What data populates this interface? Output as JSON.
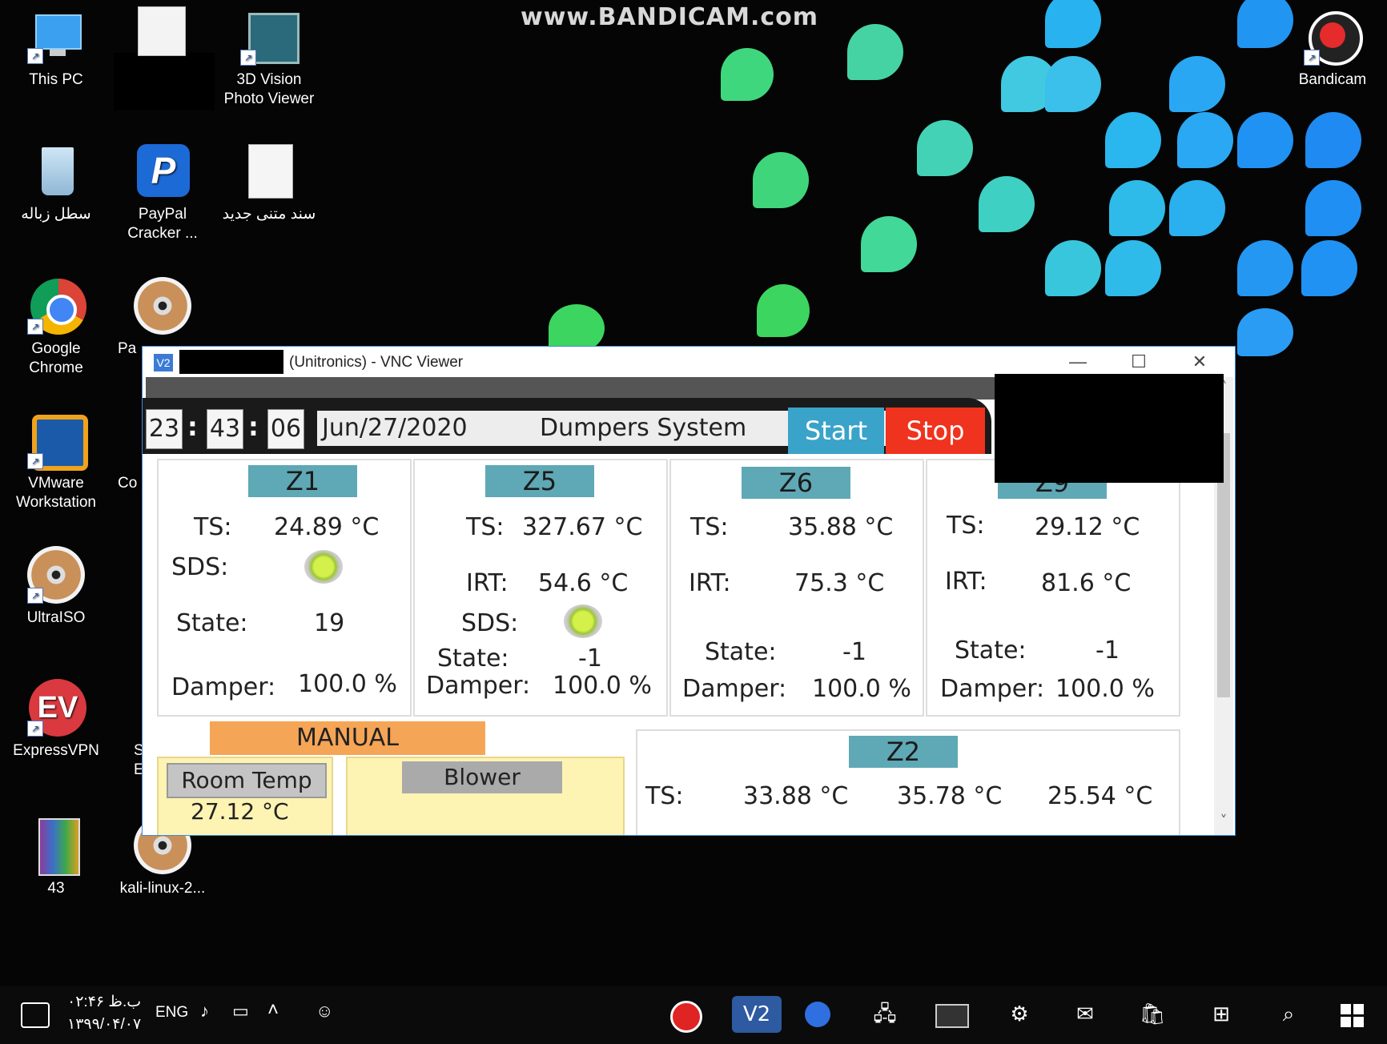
{
  "watermark": "www.BANDICAM.com",
  "desktop_icons": [
    {
      "label": "This PC",
      "icon": "computer-icon"
    },
    {
      "label": "3D Vision\nPhoto Viewer",
      "icon": "photo-viewer-icon"
    },
    {
      "label": "Bandicam",
      "icon": "bandicam-icon"
    },
    {
      "label": "سطل زباله",
      "icon": "recycle-bin-icon"
    },
    {
      "label": "PayPal\nCracker ...",
      "icon": "paypal-icon"
    },
    {
      "label": "سند متنی جدید",
      "icon": "text-document-icon"
    },
    {
      "label": "Google\nChrome",
      "icon": "chrome-icon"
    },
    {
      "label": "Pa",
      "icon": "disc-icon"
    },
    {
      "label": "VMware\nWorkstation",
      "icon": "vmware-icon"
    },
    {
      "label": "Co",
      "icon": "shortcut-icon"
    },
    {
      "label": "UltraISO",
      "icon": "disc-icon"
    },
    {
      "label": "ExpressVPN",
      "icon": "expressvpn-icon"
    },
    {
      "label": "S\nE",
      "icon": "shortcut-icon"
    },
    {
      "label": "43",
      "icon": "winrar-icon"
    },
    {
      "label": "kali-linux-2...",
      "icon": "disc-icon"
    }
  ],
  "vnc": {
    "logo": "V2",
    "title": "(Unitronics) - VNC Viewer",
    "minimize": "—",
    "maximize": "☐",
    "close": "✕",
    "scroll_up": "˄",
    "scroll_down": "˅"
  },
  "hmi": {
    "time": {
      "hh": "23",
      "mm": "43",
      "ss": "06",
      "sep": ":"
    },
    "date": "Jun/27/2020",
    "system": "Dumpers System",
    "start": "Start",
    "stop": "Stop",
    "colors": {
      "start": "#3aa3c9",
      "stop": "#f0331e",
      "zone_header": "#5fa8b5",
      "manual": "#f5a556",
      "tile": "#fdf3b2"
    },
    "labels": {
      "ts": "TS:",
      "sds": "SDS:",
      "irt": "IRT:",
      "state": "State:",
      "damper": "Damper:"
    },
    "zones": [
      {
        "name": "Z1",
        "ts": "24.89 °C",
        "state": "19",
        "damper": "100.0 %"
      },
      {
        "name": "Z5",
        "ts": "327.67 °C",
        "irt": "54.6 °C",
        "state": "-1",
        "damper": "100.0 %"
      },
      {
        "name": "Z6",
        "ts": "35.88 °C",
        "irt": "75.3 °C",
        "state": "-1",
        "damper": "100.0 %"
      },
      {
        "name": "Z9",
        "ts": "29.12 °C",
        "irt": "81.6 °C",
        "state": "-1",
        "damper": "100.0 %"
      }
    ],
    "manual": "MANUAL",
    "room_temp": "Room Temp",
    "room_temp_value": "27.12 °C",
    "blower": "Blower",
    "z2": {
      "name": "Z2",
      "ts_label": "TS:",
      "values": [
        "33.88 °C",
        "35.78 °C",
        "25.54 °C"
      ]
    }
  },
  "taskbar": {
    "time": "۰۲:۴۶ ب.ظ",
    "date": "۱۳۹۹/۰۴/۰۷",
    "lang": "ENG",
    "apps": [
      "record-icon",
      "vnc-icon",
      "shield-icon",
      "network-icon",
      "terminal-icon",
      "settings-icon",
      "mail-icon",
      "store-icon",
      "task-view-icon",
      "search-icon",
      "windows-start-icon"
    ]
  }
}
